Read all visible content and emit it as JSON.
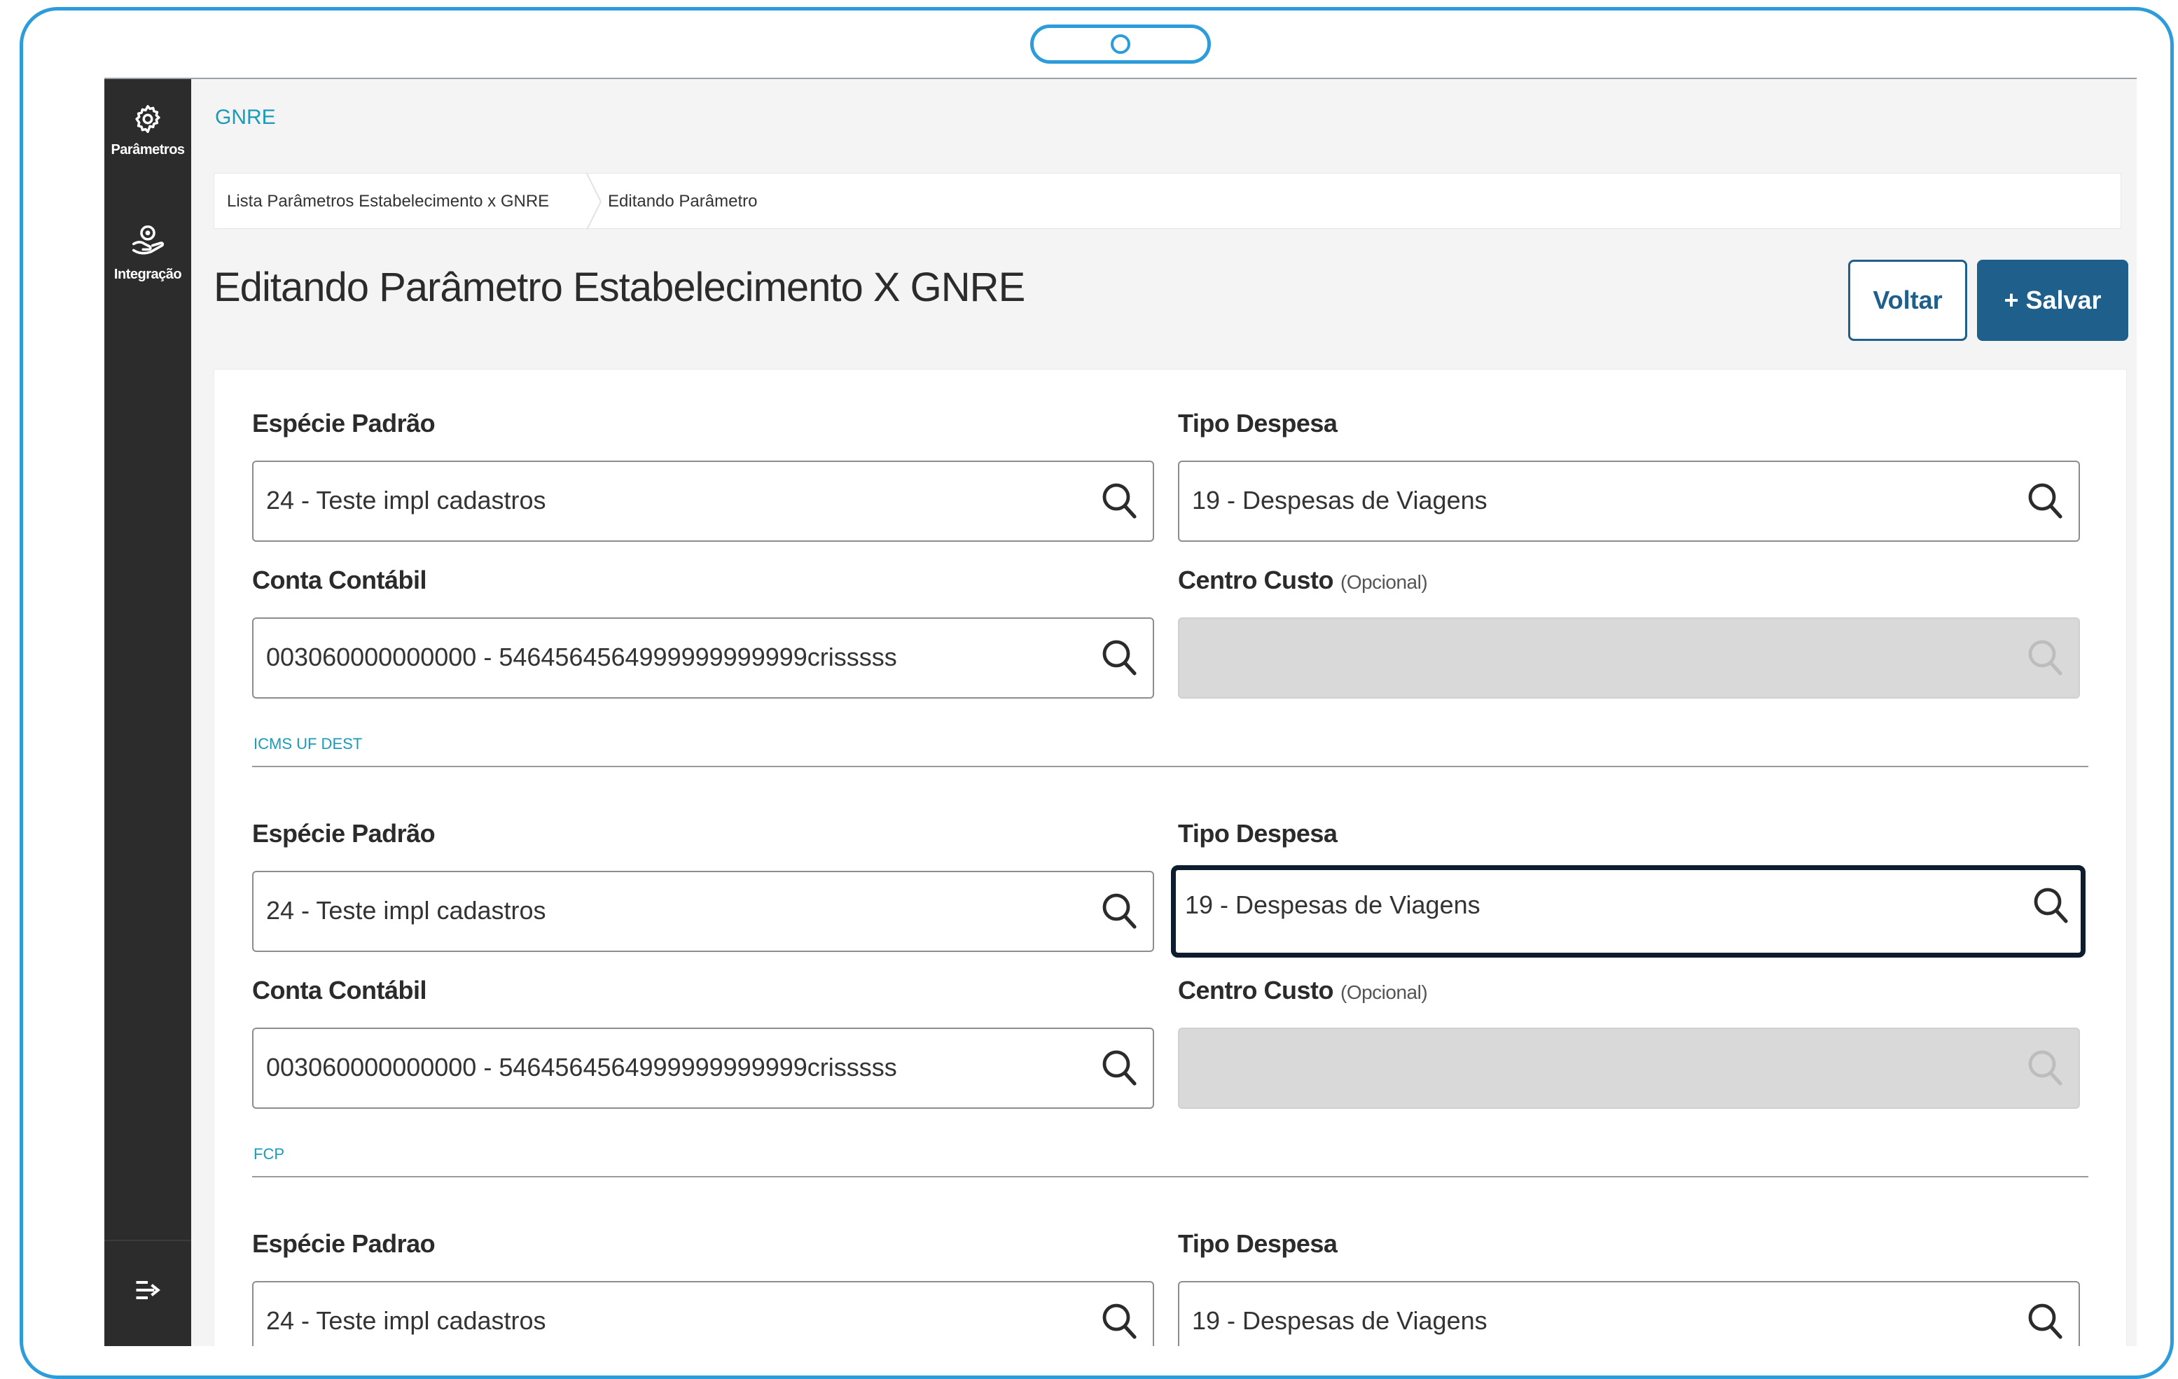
{
  "sidebar": {
    "items": [
      {
        "label": "Parâmetros",
        "icon": "gear-icon"
      },
      {
        "label": "Integração",
        "icon": "integration-icon"
      }
    ],
    "collapse_icon": "collapse-menu-icon"
  },
  "header": {
    "app_title": "GNRE",
    "breadcrumb": [
      "Lista Parâmetros Estabelecimento x GNRE",
      "Editando Parâmetro"
    ],
    "page_title": "Editando Parâmetro Estabelecimento X GNRE",
    "back_label": "Voltar",
    "save_label": "+ Salvar"
  },
  "form": {
    "group1": {
      "especie_label": "Espécie Padrão",
      "especie_value": "24 - Teste impl cadastros",
      "tipo_label": "Tipo Despesa",
      "tipo_value": "19 - Despesas de Viagens",
      "conta_label": "Conta Contábil",
      "conta_value": "003060000000000 - 5464564564999999999999crisssss",
      "centro_label": "Centro Custo",
      "centro_optional": "(Opcional)",
      "centro_value": ""
    },
    "section2_title": "ICMS UF DEST",
    "group2": {
      "especie_label": "Espécie Padrão",
      "especie_value": "24 - Teste impl cadastros",
      "tipo_label": "Tipo Despesa",
      "tipo_value": "19 - Despesas de Viagens",
      "conta_label": "Conta Contábil",
      "conta_value": "003060000000000 - 5464564564999999999999crisssss",
      "centro_label": "Centro Custo",
      "centro_optional": "(Opcional)",
      "centro_value": ""
    },
    "section3_title": "FCP",
    "group3": {
      "especie_label": "Espécie Padrao",
      "especie_value": "24 - Teste impl cadastros",
      "tipo_label": "Tipo Despesa",
      "tipo_value": "19 - Despesas de Viagens"
    }
  },
  "colors": {
    "accent": "#1a9bb8",
    "primary": "#1e5f8c",
    "sidebar": "#2c2c2c",
    "frame": "#2d9cdb"
  }
}
